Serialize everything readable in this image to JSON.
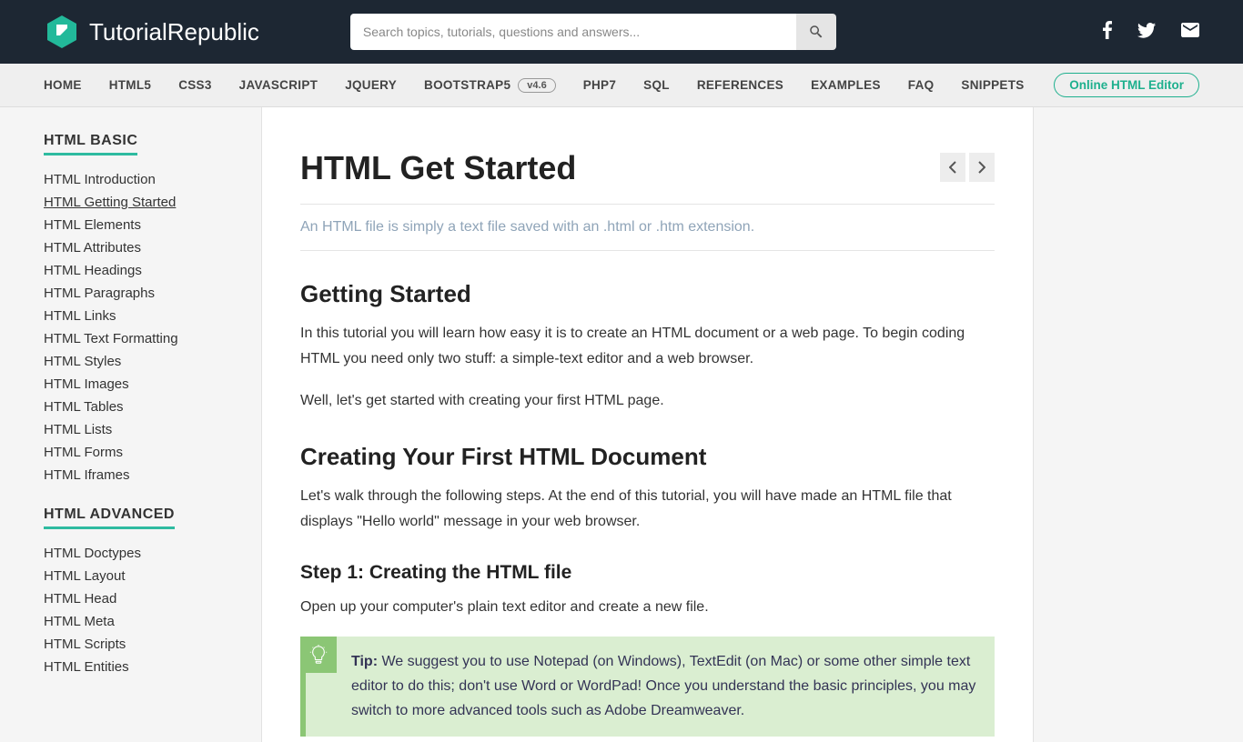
{
  "header": {
    "brand": "TutorialRepublic",
    "search_placeholder": "Search topics, tutorials, questions and answers..."
  },
  "nav": {
    "items": [
      "HOME",
      "HTML5",
      "CSS3",
      "JAVASCRIPT",
      "JQUERY",
      "BOOTSTRAP5",
      "PHP7",
      "SQL",
      "REFERENCES",
      "EXAMPLES",
      "FAQ",
      "SNIPPETS"
    ],
    "version_badge": "v4.6",
    "editor_button": "Online HTML Editor"
  },
  "sidebar": {
    "basic_heading": "HTML BASIC",
    "basic_items": [
      "HTML Introduction",
      "HTML Getting Started",
      "HTML Elements",
      "HTML Attributes",
      "HTML Headings",
      "HTML Paragraphs",
      "HTML Links",
      "HTML Text Formatting",
      "HTML Styles",
      "HTML Images",
      "HTML Tables",
      "HTML Lists",
      "HTML Forms",
      "HTML Iframes"
    ],
    "advanced_heading": "HTML ADVANCED",
    "advanced_items": [
      "HTML Doctypes",
      "HTML Layout",
      "HTML Head",
      "HTML Meta",
      "HTML Scripts",
      "HTML Entities"
    ]
  },
  "content": {
    "title": "HTML Get Started",
    "subtitle": "An HTML file is simply a text file saved with an .html or .htm extension.",
    "h2_getting": "Getting Started",
    "p1": "In this tutorial you will learn how easy it is to create an HTML document or a web page. To begin coding HTML you need only two stuff: a simple-text editor and a web browser.",
    "p2": "Well, let's get started with creating your first HTML page.",
    "h2_creating": "Creating Your First HTML Document",
    "p3": "Let's walk through the following steps. At the end of this tutorial, you will have made an HTML file that displays \"Hello world\" message in your web browser.",
    "h3_step1": "Step 1: Creating the HTML file",
    "p4": "Open up your computer's plain text editor and create a new file.",
    "tip_label": "Tip:",
    "tip_text": " We suggest you to use Notepad (on Windows), TextEdit (on Mac) or some other simple text editor to do this; don't use Word or WordPad! Once you understand the basic principles, you may switch to more advanced tools such as Adobe Dreamweaver."
  }
}
